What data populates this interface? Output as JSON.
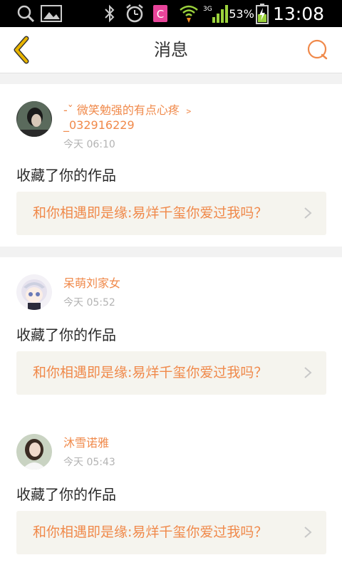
{
  "statusbar": {
    "battery_percent": "53%",
    "time": "13:08",
    "network_label": "3G"
  },
  "header": {
    "title": "消息"
  },
  "notifications": [
    {
      "username": "-ˇ  微笑勉强的有点心疼 ﹥_032916229",
      "time": "今天 06:10",
      "action": "收藏了你的作品",
      "work_title": "和你相遇即是缘:易烊千玺你爱过我吗？"
    },
    {
      "username": "呆萌刘家女",
      "time": "今天 05:52",
      "action": "收藏了你的作品",
      "work_title": "和你相遇即是缘:易烊千玺你爱过我吗？"
    },
    {
      "username": "沐雪诺雅",
      "time": "今天 05:43",
      "action": "收藏了你的作品",
      "work_title": "和你相遇即是缘:易烊千玺你爱过我吗？"
    }
  ],
  "colors": {
    "accent": "#f0894a",
    "back_arrow": "#e8b400",
    "card_link_bg": "#f5f4ee"
  }
}
